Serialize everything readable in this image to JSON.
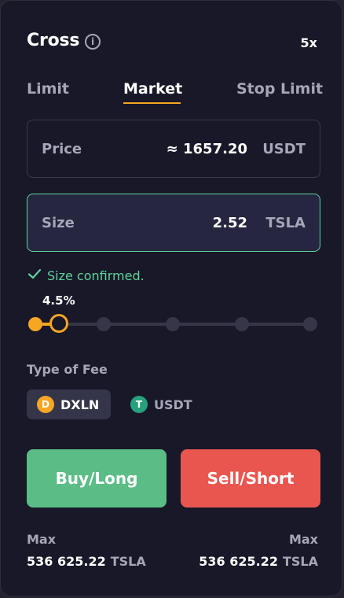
{
  "header": {
    "title": "Cross",
    "info_icon": "info-icon",
    "leverage": "5x"
  },
  "tabs": [
    {
      "label": "Limit",
      "active": false
    },
    {
      "label": "Market",
      "active": true
    },
    {
      "label": "Stop Limit",
      "active": false
    }
  ],
  "price_field": {
    "label": "Price",
    "value": "≈ 1657.20",
    "unit": "USDT"
  },
  "size_field": {
    "label": "Size",
    "value": "2.52",
    "unit": "TSLA"
  },
  "confirmation": {
    "icon": "check-icon",
    "text": "Size confirmed."
  },
  "slider": {
    "label": "4.5%",
    "value_percent": 4.5,
    "steps": 9
  },
  "fee": {
    "label": "Type of Fee",
    "options": [
      {
        "label": "DXLN",
        "icon": "dxln-coin-icon",
        "selected": true
      },
      {
        "label": "USDT",
        "icon": "usdt-coin-icon",
        "selected": false
      }
    ]
  },
  "actions": {
    "buy_label": "Buy/Long",
    "sell_label": "Sell/Short"
  },
  "max": {
    "left": {
      "label": "Max",
      "value": "536 625.22",
      "unit": "TSLA"
    },
    "right": {
      "label": "Max",
      "value": "536 625.22",
      "unit": "TSLA"
    }
  },
  "colors": {
    "background": "#181828",
    "accent": "#f5a623",
    "success": "#5fd39a",
    "buy": "#5bbd85",
    "sell": "#e9564f",
    "muted": "#a6a6b8"
  }
}
